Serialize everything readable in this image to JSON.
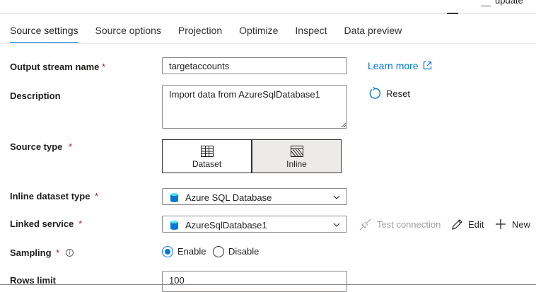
{
  "header": {
    "update_label": "update"
  },
  "tabs": [
    {
      "label": "Source settings",
      "active": true
    },
    {
      "label": "Source options"
    },
    {
      "label": "Projection"
    },
    {
      "label": "Optimize"
    },
    {
      "label": "Inspect"
    },
    {
      "label": "Data preview"
    }
  ],
  "form": {
    "output_stream_name": {
      "label": "Output stream name",
      "value": "targetaccounts",
      "required_mark": "*"
    },
    "learn_more": "Learn more",
    "description": {
      "label": "Description",
      "value": "Import data from AzureSqlDatabase1"
    },
    "reset": "Reset",
    "source_type": {
      "label": "Source type",
      "required_mark": "*",
      "options": [
        "Dataset",
        "Inline"
      ],
      "selected": "Inline"
    },
    "inline_dataset_type": {
      "label": "Inline dataset type",
      "required_mark": "*",
      "value": "Azure SQL Database"
    },
    "linked_service": {
      "label": "Linked service",
      "required_mark": "*",
      "value": "AzureSqlDatabase1",
      "test_connection": "Test connection",
      "edit": "Edit",
      "new": "New"
    },
    "sampling": {
      "label": "Sampling",
      "required_mark": "*",
      "options": [
        "Enable",
        "Disable"
      ],
      "selected": "Enable"
    },
    "rows_limit": {
      "label": "Rows limit",
      "value": "100"
    }
  },
  "colors": {
    "accent": "#0078d4",
    "required": "#a4262c",
    "disabled": "#a19f9d"
  }
}
